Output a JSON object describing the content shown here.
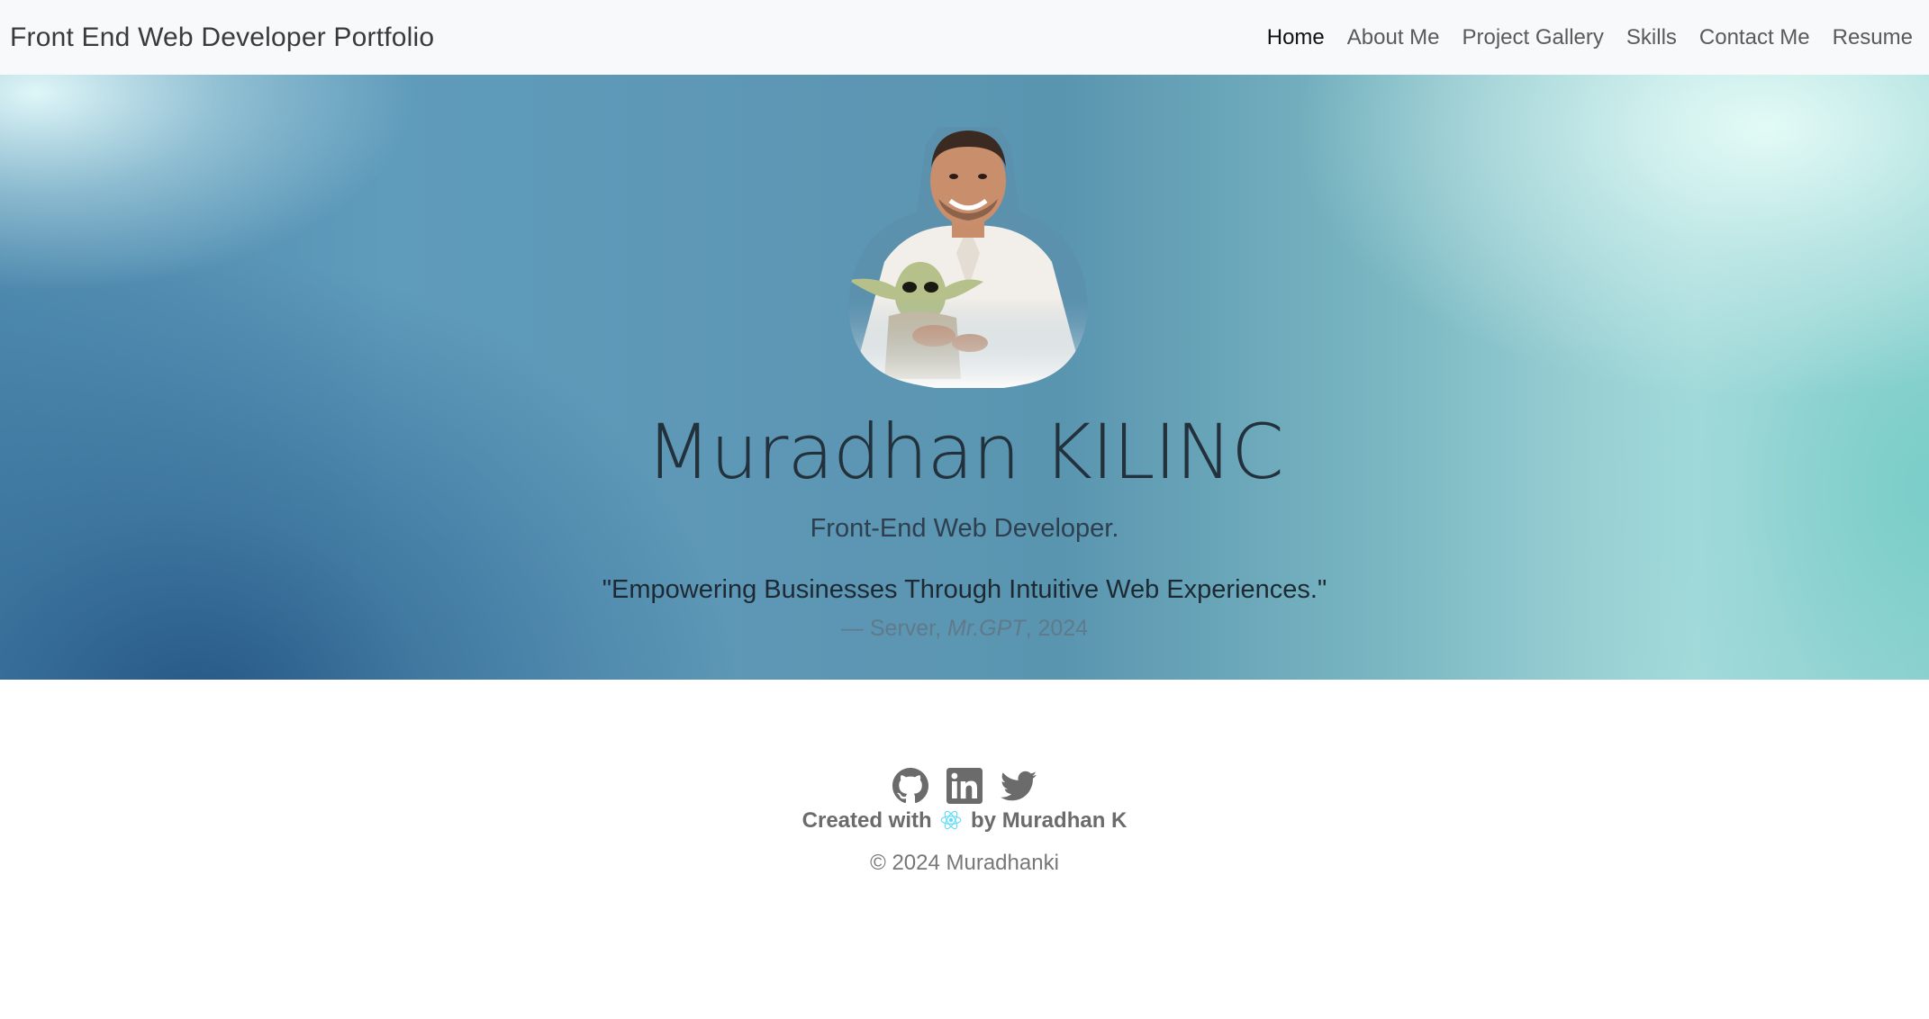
{
  "navbar": {
    "brand": "Front End Web Developer Portfolio",
    "links": [
      {
        "label": "Home",
        "active": true
      },
      {
        "label": "About Me"
      },
      {
        "label": "Project Gallery"
      },
      {
        "label": "Skills"
      },
      {
        "label": "Contact Me"
      },
      {
        "label": "Resume"
      }
    ]
  },
  "hero": {
    "name": "Muradhan KILINC",
    "role": "Front-End Web Developer.",
    "quote": "\"Empowering Businesses Through Intuitive Web Experiences.\"",
    "cite_prefix": "— Server, ",
    "cite_source": "Mr.GPT",
    "cite_suffix": ", 2024"
  },
  "footer": {
    "social_icons": [
      "github-icon",
      "linkedin-icon",
      "twitter-icon"
    ],
    "created_prefix": "Created with",
    "created_suffix": "by Muradhan K",
    "copyright": "© 2024 Muradhanki"
  },
  "colors": {
    "navbar_bg": "#f8f9fa",
    "hero_blue": "#5a95b0",
    "hero_teal": "#a8dcdc",
    "react_cyan": "#61dafb",
    "icon_gray": "#6b6b6b"
  }
}
